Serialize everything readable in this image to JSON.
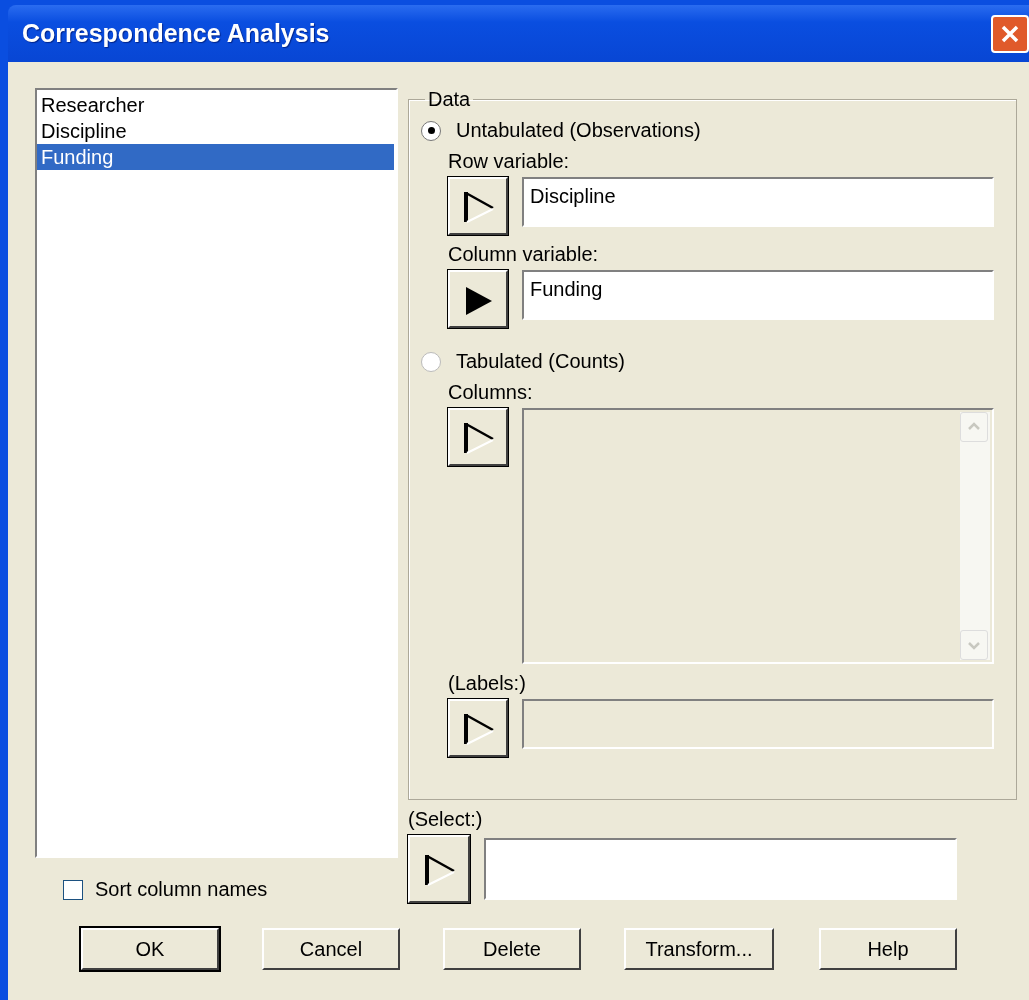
{
  "window": {
    "title": "Correspondence Analysis"
  },
  "variables": [
    {
      "name": "Researcher",
      "selected": false
    },
    {
      "name": "Discipline",
      "selected": false
    },
    {
      "name": "Funding",
      "selected": true
    }
  ],
  "sort_column_names": {
    "label": "Sort column names",
    "checked": false
  },
  "data_group": {
    "title": "Data",
    "options": [
      {
        "label": "Untabulated (Observations)",
        "selected": true,
        "fields": [
          {
            "kind": "line",
            "label": "Row variable:",
            "value": "Discipline",
            "active": false,
            "enabled": true
          },
          {
            "kind": "line",
            "label": "Column variable:",
            "value": "Funding",
            "active": true,
            "enabled": true
          }
        ]
      },
      {
        "label": "Tabulated (Counts)",
        "selected": false,
        "fields": [
          {
            "kind": "list",
            "label": "Columns:",
            "active": false,
            "enabled": false
          },
          {
            "kind": "line",
            "label": "(Labels:)",
            "active": false,
            "enabled": false
          }
        ]
      }
    ]
  },
  "select": {
    "label": "(Select:)",
    "active": false,
    "enabled": true
  },
  "buttons": [
    {
      "label": "OK",
      "default": true
    },
    {
      "label": "Cancel",
      "default": false
    },
    {
      "label": "Delete",
      "default": false
    },
    {
      "label": "Transform...",
      "default": false
    },
    {
      "label": "Help",
      "default": false
    }
  ]
}
